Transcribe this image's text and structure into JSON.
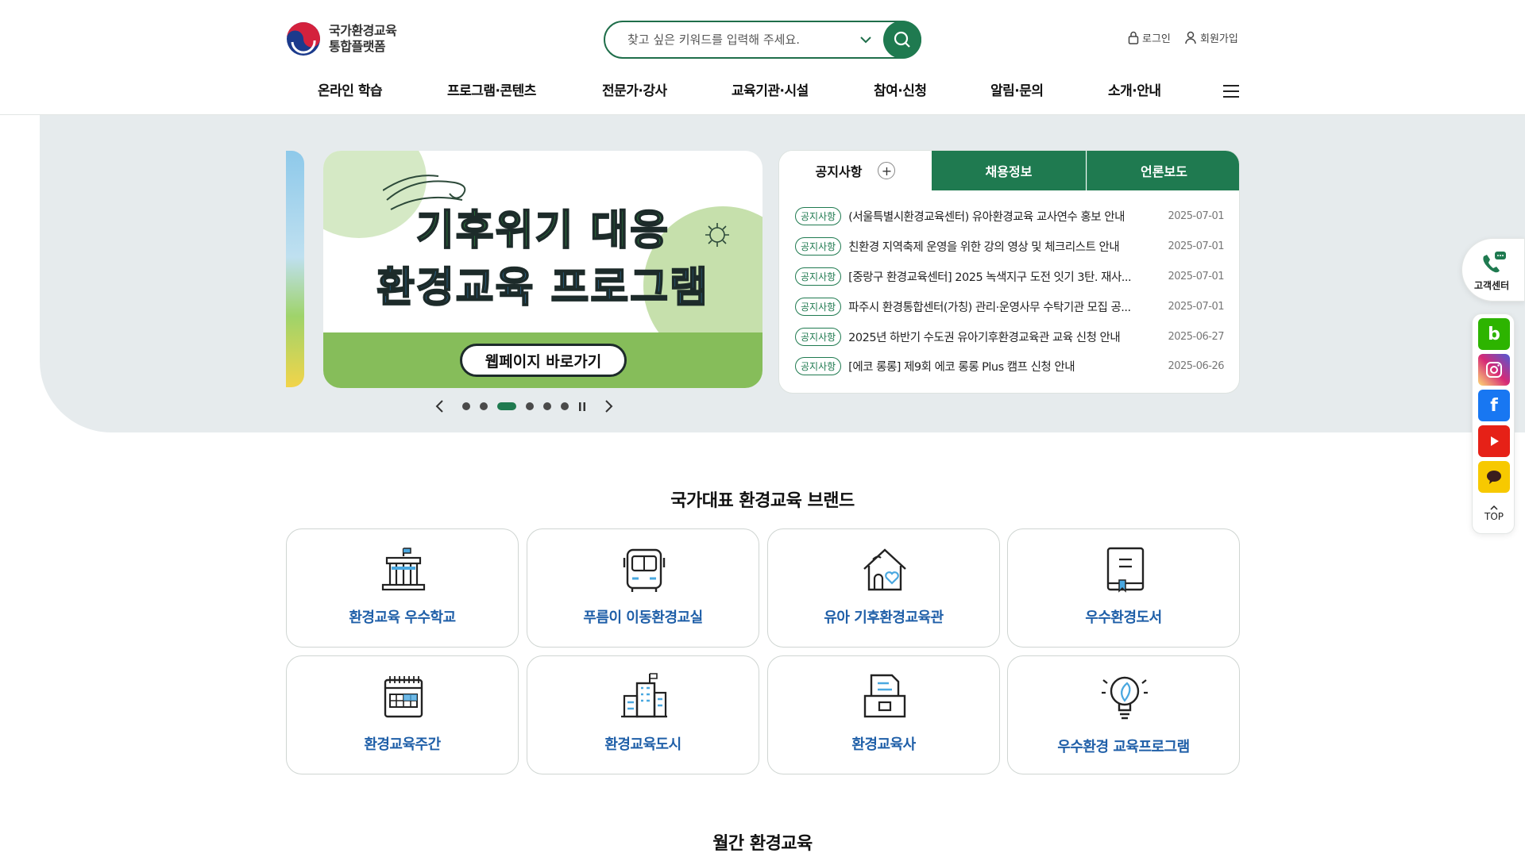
{
  "header": {
    "logo_line1": "국가환경교육",
    "logo_line2": "통합플랫폼",
    "search_placeholder": "찾고 싶은 키워드를 입력해 주세요.",
    "login": "로그인",
    "signup": "회원가입",
    "nav": [
      "온라인 학습",
      "프로그램·콘텐츠",
      "전문가·강사",
      "교육기관·시설",
      "참여·신청",
      "알림·문의",
      "소개·안내"
    ]
  },
  "banner": {
    "title_line1": "기후위기 대응",
    "title_line2": "환경교육 프로그램",
    "button": "웹페이지 바로가기",
    "slides_total": 6,
    "active_slide": 3
  },
  "notice": {
    "tabs": [
      "공지사항",
      "채용정보",
      "언론보도"
    ],
    "items": [
      {
        "badge": "공지사항",
        "title": "(서울특별시환경교육센터) 유아환경교육 교사연수 홍보 안내",
        "date": "2025-07-01"
      },
      {
        "badge": "공지사항",
        "title": "친환경 지역축제 운영을 위한 강의 영상 및 체크리스트 안내",
        "date": "2025-07-01"
      },
      {
        "badge": "공지사항",
        "title": "[중랑구 환경교육센터] 2025 녹색지구 도전 잇기 3탄. 재사...",
        "date": "2025-07-01"
      },
      {
        "badge": "공지사항",
        "title": "파주시 환경통합센터(가칭) 관리·운영사무 수탁기관 모집 공...",
        "date": "2025-07-01"
      },
      {
        "badge": "공지사항",
        "title": "2025년 하반기 수도권 유아기후환경교육관 교육 신청 안내",
        "date": "2025-06-27"
      },
      {
        "badge": "공지사항",
        "title": "[에코 롱롱] 제9회 에코 롱롱 Plus 캠프 신청 안내",
        "date": "2025-06-26"
      }
    ]
  },
  "brand": {
    "title": "국가대표 환경교육 브랜드",
    "cards": [
      {
        "label": "환경교육 우수학교",
        "icon": "school-icon"
      },
      {
        "label": "푸름이 이동환경교실",
        "icon": "bus-icon"
      },
      {
        "label": "유아 기후환경교육관",
        "icon": "house-heart-icon"
      },
      {
        "label": "우수환경도서",
        "icon": "book-icon"
      },
      {
        "label": "환경교육주간",
        "icon": "calendar-icon"
      },
      {
        "label": "환경교육도시",
        "icon": "city-icon"
      },
      {
        "label": "환경교육사",
        "icon": "certificate-icon"
      },
      {
        "label": "우수환경 교육프로그램",
        "icon": "lightbulb-icon"
      }
    ]
  },
  "monthly": {
    "title": "월간 환경교육"
  },
  "side": {
    "customer_center": "고객센터",
    "top": "TOP",
    "sns": [
      {
        "name": "blog",
        "color": "#2db400"
      },
      {
        "name": "instagram",
        "color": "#d62976"
      },
      {
        "name": "facebook",
        "color": "#1877f2"
      },
      {
        "name": "youtube",
        "color": "#e62117"
      },
      {
        "name": "kakao",
        "color": "#f7c900"
      }
    ]
  },
  "colors": {
    "primary": "#1f7a50",
    "brand_label": "#1f5fa8",
    "hero_bg": "#e6ebed"
  }
}
